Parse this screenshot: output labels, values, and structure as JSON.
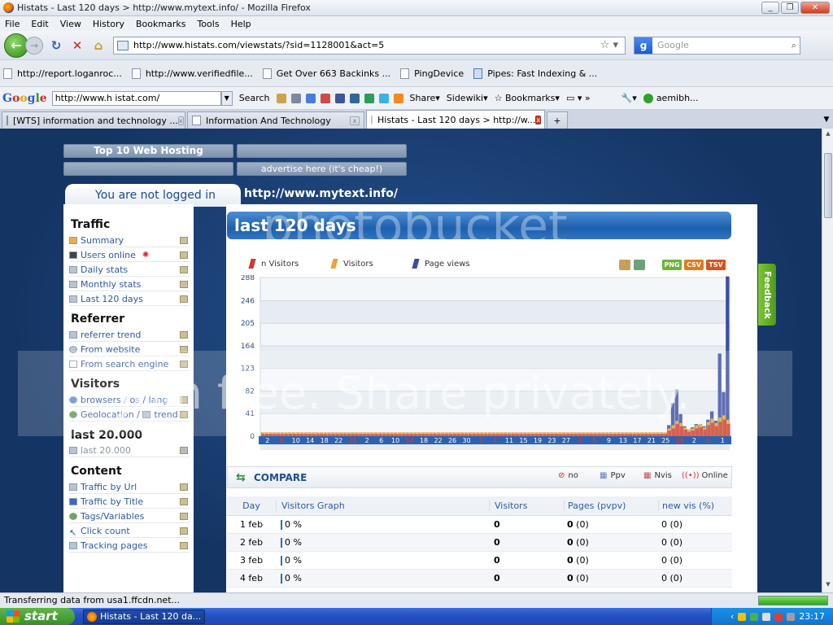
{
  "window": {
    "title": "Histats - Last 120 days > http://www.mytext.info/ - Mozilla Firefox"
  },
  "menu": [
    "File",
    "Edit",
    "View",
    "History",
    "Bookmarks",
    "Tools",
    "Help"
  ],
  "nav": {
    "url": "http://www.histats.com/viewstats/?sid=1128001&act=5",
    "search_placeholder": "Google"
  },
  "bookmarks": [
    "http://report.loganroc...",
    "http://www.verifiedfile...",
    "Get Over 663 Backinks ...",
    "PingDevice",
    "Pipes: Fast Indexing & ..."
  ],
  "googlebar": {
    "input": "http://www.h istat.com/",
    "search": "Search",
    "share": "Share",
    "sidewiki": "Sidewiki",
    "bookmarks": "Bookmarks",
    "user": "aemibh..."
  },
  "tabs": [
    "[WTS] information and technology ...",
    "Information And Technology",
    "Histats - Last 120 days > http://w..."
  ],
  "ads": {
    "top10": "Top 10 Web Hosting",
    "advertise": "advertise here (it's cheap!)"
  },
  "login": "You are not logged in",
  "site": "http://www.mytext.info/",
  "left": {
    "traffic": {
      "title": "Traffic",
      "items": [
        "Summary",
        "Users online",
        "Daily stats",
        "Monthly stats",
        "Last 120 days"
      ]
    },
    "referrer": {
      "title": "Referrer",
      "items": [
        "referrer trend",
        "From website",
        "From search engine"
      ]
    },
    "visitors": {
      "title": "Visitors",
      "browsers": "browsers",
      "os": "os",
      "lang": "lang",
      "geo": "Geolocation",
      "trend": "trend"
    },
    "last20": {
      "title": "last 20.000",
      "item": "last 20.000"
    },
    "content": {
      "title": "Content",
      "items": [
        "Traffic by Url",
        "Traffic by Title",
        "Tags/Variables",
        "Click count",
        "Tracking pages"
      ]
    }
  },
  "range": "last 120 days",
  "legend": [
    "n Visitors",
    "Visitors",
    "Page views"
  ],
  "exports": [
    "PNG",
    "CSV",
    "TSV"
  ],
  "chart_data": {
    "type": "bar",
    "y_ticks": [
      288,
      246,
      205,
      164,
      123,
      82,
      41,
      0
    ],
    "ylim": [
      0,
      288
    ],
    "x_tick_labels": [
      "2",
      "6",
      "10",
      "14",
      "18",
      "22",
      "26",
      "2",
      "6",
      "10",
      "14",
      "18",
      "22",
      "26",
      "30",
      "3",
      "7",
      "11",
      "15",
      "19",
      "23",
      "27",
      "1",
      "5",
      "9",
      "13",
      "17",
      "21",
      "25",
      "29",
      "2",
      "6",
      "1"
    ],
    "x_tick_red": [
      1,
      6,
      10,
      15,
      16,
      22,
      23,
      29,
      31
    ],
    "series": [
      {
        "name": "n Visitors",
        "color": "#d23b2c",
        "values": [
          4,
          4,
          4,
          4,
          4,
          4,
          4,
          4,
          4,
          4,
          4,
          4,
          4,
          4,
          4,
          4,
          4,
          4,
          4,
          4,
          4,
          4,
          4,
          4,
          4,
          4,
          4,
          4,
          4,
          4,
          4,
          4,
          4,
          4,
          4,
          4,
          4,
          4,
          4,
          4,
          4,
          4,
          4,
          4,
          4,
          4,
          4,
          4,
          4,
          4,
          4,
          4,
          4,
          4,
          4,
          4,
          4,
          4,
          4,
          4,
          4,
          4,
          4,
          4,
          4,
          4,
          4,
          4,
          4,
          4,
          4,
          4,
          4,
          4,
          4,
          4,
          4,
          4,
          4,
          4,
          4,
          4,
          4,
          4,
          4,
          4,
          4,
          4,
          4,
          4,
          4,
          4,
          4,
          4,
          4,
          4,
          4,
          4,
          4,
          4,
          4,
          4,
          4,
          4,
          10,
          14,
          22,
          18,
          12,
          8,
          10,
          14,
          16,
          12,
          20,
          24,
          18,
          26,
          30,
          22
        ]
      },
      {
        "name": "Visitors",
        "color": "#e8a33a",
        "values": [
          7,
          7,
          7,
          7,
          7,
          7,
          7,
          7,
          7,
          7,
          7,
          7,
          7,
          7,
          7,
          7,
          7,
          7,
          7,
          7,
          7,
          7,
          7,
          7,
          7,
          7,
          7,
          7,
          7,
          7,
          7,
          7,
          7,
          7,
          7,
          7,
          7,
          7,
          7,
          7,
          7,
          7,
          7,
          7,
          7,
          7,
          7,
          7,
          7,
          7,
          7,
          7,
          7,
          7,
          7,
          7,
          7,
          7,
          7,
          7,
          7,
          7,
          7,
          7,
          7,
          7,
          7,
          7,
          7,
          7,
          7,
          7,
          7,
          7,
          7,
          7,
          7,
          7,
          7,
          7,
          7,
          7,
          7,
          7,
          7,
          7,
          7,
          7,
          7,
          7,
          7,
          7,
          7,
          7,
          7,
          7,
          7,
          7,
          7,
          7,
          7,
          7,
          7,
          7,
          14,
          20,
          28,
          24,
          16,
          12,
          14,
          20,
          22,
          16,
          26,
          32,
          24,
          34,
          38,
          30
        ]
      },
      {
        "name": "Page views",
        "color": "#3a4fa4",
        "values": [
          0,
          0,
          0,
          0,
          0,
          0,
          0,
          0,
          0,
          0,
          0,
          0,
          0,
          0,
          0,
          0,
          0,
          0,
          0,
          0,
          0,
          0,
          0,
          0,
          0,
          0,
          0,
          0,
          0,
          0,
          0,
          0,
          0,
          0,
          0,
          0,
          0,
          0,
          0,
          0,
          0,
          0,
          0,
          0,
          0,
          0,
          0,
          0,
          0,
          0,
          0,
          0,
          0,
          0,
          0,
          0,
          0,
          0,
          0,
          0,
          0,
          0,
          0,
          0,
          0,
          0,
          0,
          0,
          0,
          0,
          0,
          0,
          0,
          0,
          0,
          0,
          0,
          0,
          0,
          0,
          0,
          0,
          0,
          0,
          0,
          0,
          0,
          0,
          0,
          0,
          0,
          0,
          0,
          0,
          0,
          0,
          0,
          0,
          0,
          0,
          0,
          0,
          0,
          0,
          20,
          60,
          85,
          40,
          18,
          12,
          16,
          22,
          20,
          18,
          30,
          45,
          28,
          150,
          80,
          290
        ]
      }
    ]
  },
  "compare": {
    "label": "COMPARE",
    "no": "no",
    "ppv": "Ppv",
    "nvis": "Nvis",
    "online": "Online"
  },
  "table": {
    "headers": [
      "Day",
      "Visitors Graph",
      "Visitors",
      "Pages (pvpv)",
      "new vis (%)"
    ],
    "rows": [
      {
        "day": "1 feb",
        "graph": "0 %",
        "visitors": "0",
        "pages": "0",
        "pages_p": "(0)",
        "newvis": "0 (0)"
      },
      {
        "day": "2 feb",
        "graph": "0 %",
        "visitors": "0",
        "pages": "0",
        "pages_p": "(0)",
        "newvis": "0 (0)"
      },
      {
        "day": "3 feb",
        "graph": "0 %",
        "visitors": "0",
        "pages": "0",
        "pages_p": "(0)",
        "newvis": "0 (0)"
      },
      {
        "day": "4 feb",
        "graph": "0 %",
        "visitors": "0",
        "pages": "0",
        "pages_p": "(0)",
        "newvis": "0 (0)"
      }
    ]
  },
  "feedback": "Feedback",
  "watermark": {
    "top": "photobucket",
    "main": "Join free. Share privately."
  },
  "status": "Transferring data from usa1.ffcdn.net...",
  "taskbar": {
    "start": "start",
    "task": "Histats - Last 120 da...",
    "clock": "23:17"
  }
}
